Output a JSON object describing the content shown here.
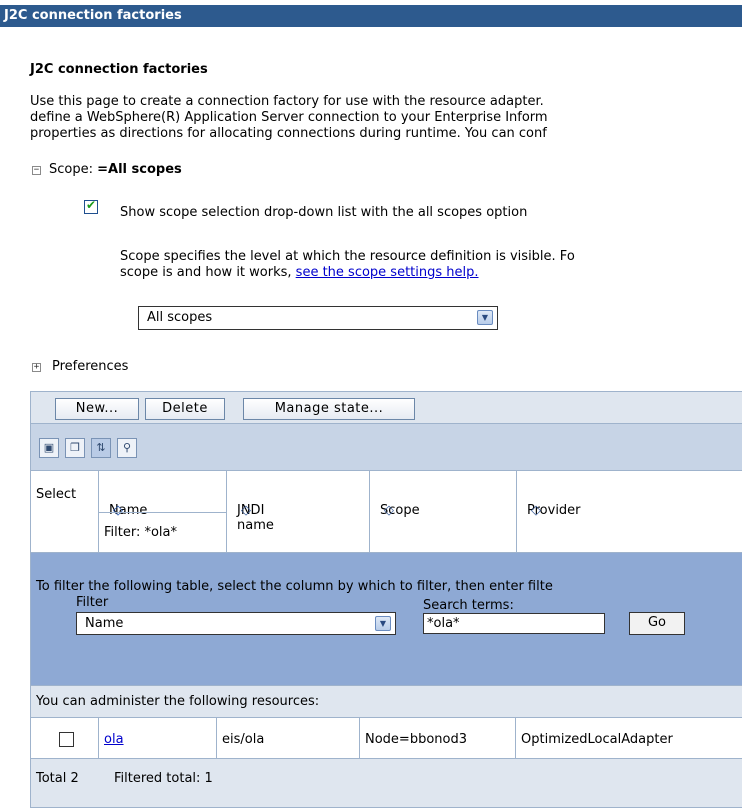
{
  "window": {
    "title": "J2C connection factories"
  },
  "page": {
    "heading": "J2C connection factories",
    "description": [
      "Use this page to create a connection factory for use with the resource adapter.",
      "define a WebSphere(R) Application Server connection to your Enterprise Inform",
      "properties as directions for allocating connections during runtime. You can conf"
    ]
  },
  "scope": {
    "toggle": "−",
    "label": "Scope: ",
    "value": "=All scopes",
    "checkbox_label": "Show scope selection drop-down list with the all scopes option",
    "checkbox_checked": true,
    "help_line1": "Scope specifies the level at which the resource definition is visible. Fo",
    "help_line2_prefix": "scope is and how it works, ",
    "help_link": "see the scope settings help.",
    "selected": "All scopes"
  },
  "preferences": {
    "toggle": "+",
    "label": "Preferences"
  },
  "toolbar": {
    "new_label": "New...",
    "delete_label": "Delete",
    "manage_label": "Manage state..."
  },
  "icons": [
    "select-all-icon",
    "deselect-all-icon",
    "show-filter-icon",
    "clear-filter-icon"
  ],
  "table": {
    "headers": [
      "Select",
      "Name",
      "JNDI name",
      "Scope",
      "Provider"
    ],
    "sort_glyph": "◇",
    "active_sort_glyph": "◇",
    "name_filter": "Filter: *ola*"
  },
  "filter": {
    "instructions": "To filter the following table, select the column by which to filter, then enter filte",
    "filter_label": "Filter",
    "filter_value": "Name",
    "search_label": "Search terms:",
    "search_value": "*ola*",
    "go_label": "Go"
  },
  "admin_text": "You can administer the following resources:",
  "rows": [
    {
      "name": "ola",
      "jndi": "eis/ola",
      "scope": "Node=bbonod3",
      "provider": "OptimizedLocalAdapter"
    }
  ],
  "totals": {
    "total": "Total 2",
    "filtered": "Filtered total: 1"
  },
  "colors": {
    "title_bar": "#2d5a8e",
    "filter_panel": "#8ea9d4",
    "toolbar": "#dfe6ef"
  }
}
